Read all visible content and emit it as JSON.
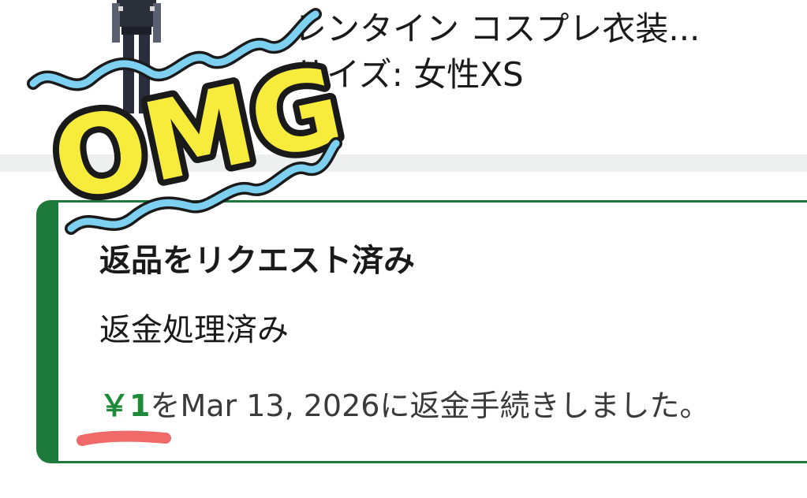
{
  "product": {
    "name": "レンタイン コスプレ衣装...",
    "size": "サイズ: 女性XS"
  },
  "status_card": {
    "title": "返品をリクエスト済み",
    "subtitle": "返金処理済み",
    "refund_amount": "￥1",
    "refund_text": "をMar 13, 2026に返金手続きしました。"
  },
  "sticker": {
    "text": "OMG"
  },
  "colors": {
    "accent_green": "#1e7a3a",
    "amount_green": "#1f8a3a",
    "sticker_yellow": "#f7ec3c",
    "sticker_blue": "#7ed0f0",
    "marker_red": "#f06a6a"
  }
}
